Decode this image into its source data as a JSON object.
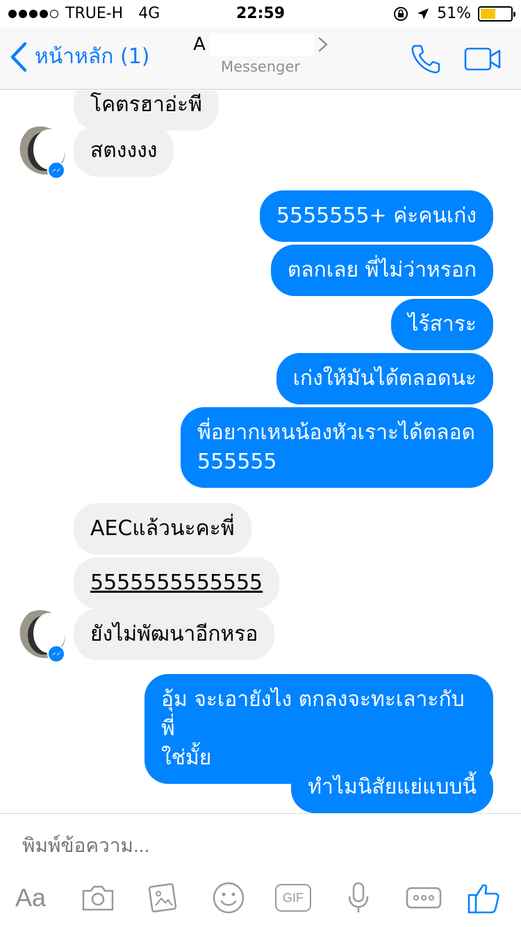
{
  "status_bar": {
    "carrier": "TRUE-H",
    "network": "4G",
    "time": "22:59",
    "battery": "51%",
    "battery_level": 0.51
  },
  "nav": {
    "back_label": "หน้าหลัก (1)",
    "title_visible": "A",
    "subtitle": "Messenger"
  },
  "messages": [
    {
      "dir": "in",
      "text": "โคตรฮาอ่ะพี"
    },
    {
      "dir": "in",
      "text": "สตงงงง"
    },
    {
      "dir": "out",
      "text": "5555555+ ค่ะคนเก่ง"
    },
    {
      "dir": "out",
      "text": "ตลกเลย พี่ไม่ว่าหรอก"
    },
    {
      "dir": "out",
      "text": "ไร้สาระ"
    },
    {
      "dir": "out",
      "text": "เก่งให้มันได้ตลอดนะ"
    },
    {
      "dir": "out",
      "text": "พี่อยากเหนน้องหัวเราะได้ตลอด",
      "text2": "555555"
    },
    {
      "dir": "in",
      "text": "AECแล้วนะคะพี่"
    },
    {
      "dir": "in",
      "text": "5555555555555"
    },
    {
      "dir": "in",
      "text": "ยังไม่พัฒนาอีกหรอ"
    },
    {
      "dir": "out",
      "text": "อุ้ม จะเอายังไง ตกลงจะทะเลาะกับพี่",
      "text2": "ใช่มั้ย"
    },
    {
      "dir": "out",
      "text": "ทำไมนิสัยแย่แบบนี้"
    }
  ],
  "composer": {
    "placeholder": "พิมพ์ข้อความ...",
    "aa_label": "Aa",
    "gif_label": "GIF"
  },
  "colors": {
    "accent": "#0e7cff",
    "outgoing_bubble": "#0084ff",
    "incoming_bubble": "#f0f0f0",
    "battery": "#f6c400"
  }
}
